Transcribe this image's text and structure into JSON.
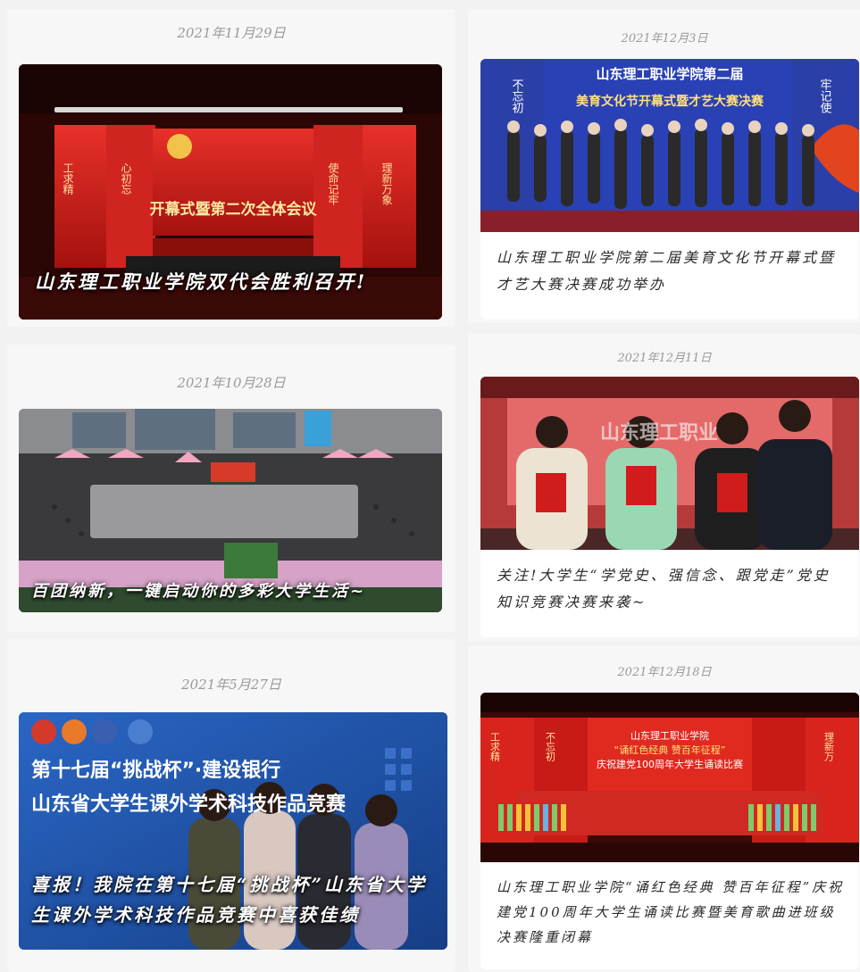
{
  "cards": [
    {
      "date": "2021年11月29日",
      "overlay_text": "山东理工职业学院双代会胜利召开!",
      "screen_title": "开幕式暨第二次全体会议",
      "pillars": [
        "工求精",
        "心初忘",
        "使命记牢",
        "理新万象"
      ]
    },
    {
      "date": "2021年12月3日",
      "banner_line1": "山东理工职业学院第二届",
      "banner_line2": "美育文化节开幕式暨才艺大赛决赛",
      "side_left": "不忘初",
      "side_right": "牢记使",
      "caption": "山东理工职业学院第二届美育文化节开幕式暨才艺大赛决赛成功举办"
    },
    {
      "date": "2021年10月28日",
      "overlay_text": "百团纳新，一键启动你的多彩大学生活~"
    },
    {
      "date": "2021年12月11日",
      "screen_text": "山东理工职业",
      "caption": "关注!大学生“学党史、强信念、跟党走”党史知识竞赛决赛来袭~"
    },
    {
      "date": "2021年5月27日",
      "poster_line1": "第十七届“挑战杯”·建设银行",
      "poster_line2": "山东省大学生课外学术科技作品竞赛",
      "overlay_text": "喜报！我院在第十七届“挑战杯”山东省大学生课外学术科技作品竞赛中喜获佳绩"
    },
    {
      "date": "2021年12月18日",
      "screen_line1": "山东理工职业学院",
      "screen_line2": "“诵红色经典 赞百年征程”",
      "screen_line3": "庆祝建党100周年大学生诵读比赛",
      "pillars": [
        "工求精",
        "不忘初",
        "理新万"
      ],
      "caption": "山东理工职业学院“诵红色经典 赞百年征程”庆祝建党100周年大学生诵读比赛暨美育歌曲进班级决赛隆重闭幕"
    }
  ],
  "colors": {
    "stage_red": "#c81a16",
    "deep_red": "#7a0d0a",
    "poster_blue": "#1f4fa3",
    "page_bg": "#f2f2f2"
  }
}
